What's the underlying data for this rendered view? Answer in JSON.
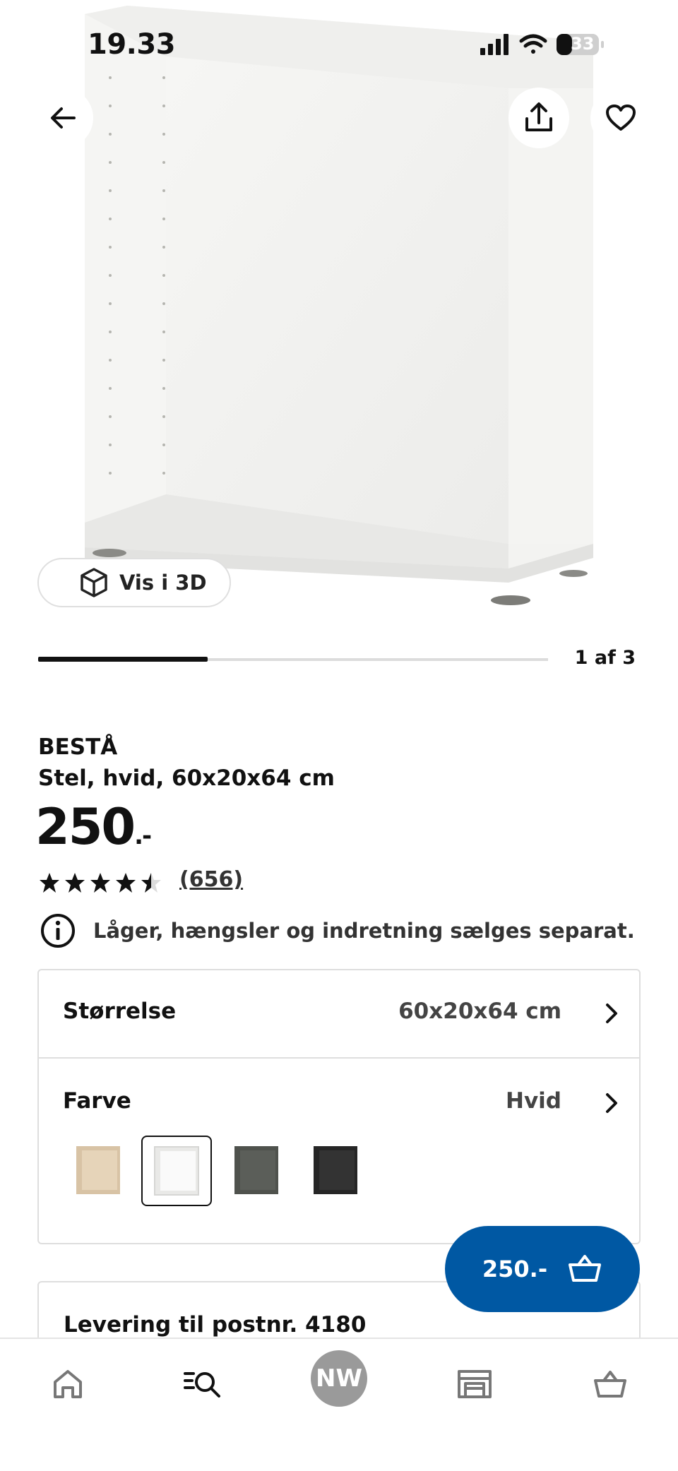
{
  "status_bar": {
    "time": "19.33",
    "battery": "33"
  },
  "hero": {
    "vis3d_label": "Vis i 3D"
  },
  "carousel": {
    "counter": "1 af 3",
    "progress_fraction": 0.333
  },
  "product": {
    "brand": "BESTÅ",
    "description": "Stel, hvid, 60x20x64 cm",
    "price": "250",
    "price_suffix": ".-",
    "rating": 4.5,
    "rating_count": "(656)",
    "notice": "Låger, hængsler og indretning sælges separat."
  },
  "options": {
    "size_label": "Størrelse",
    "size_value": "60x20x64 cm",
    "color_label": "Farve",
    "color_value": "Hvid",
    "swatches": [
      {
        "name": "white-stained-oak",
        "color": "#d8c3a5"
      },
      {
        "name": "white",
        "color": "#f4f4f4",
        "selected": true
      },
      {
        "name": "dark-grey",
        "color": "#4f524d"
      },
      {
        "name": "black-brown",
        "color": "#262626"
      }
    ]
  },
  "delivery": {
    "label": "Levering til postnr. 4180"
  },
  "buy_button": {
    "price": "250.-"
  },
  "bottom_nav": {
    "avatar_initials": "NW"
  },
  "colors": {
    "accent": "#0058a3",
    "avatar": "#9a9a9a"
  }
}
